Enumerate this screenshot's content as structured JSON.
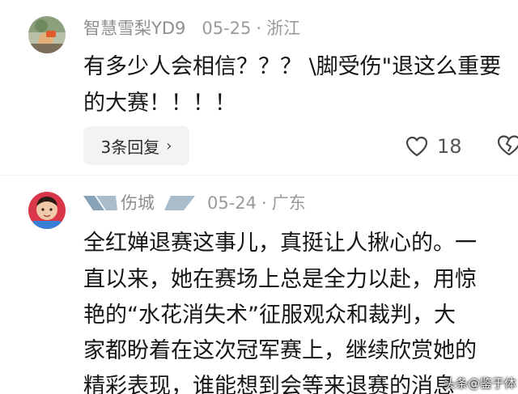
{
  "comments": [
    {
      "username": "智慧雪梨YD9",
      "date": "05-25",
      "location": "浙江",
      "text_lines": [
        "有多少人会相信？？？ \\脚受伤\"退这么重要",
        "的大赛！！！！"
      ],
      "reply_button_label": "3条回复",
      "likes": "18",
      "avatar_icon": "hand-photo-avatar"
    },
    {
      "username": "伤城",
      "date": "05-24",
      "location": "广东",
      "text_lines": [
        "全红婵退赛这事儿，真挺让人揪心的。一",
        "直以来，她在赛场上总是全力以赴，用惊",
        "艳的“水花消失术”征服观众和裁判，大",
        "家都盼着在这次冠军赛上，继续欣赏她的",
        "精彩表现，谁能想到会等来退赛的消息"
      ],
      "avatar_icon": "child-photo-avatar"
    }
  ],
  "watermark": "头条@鉴于体",
  "colors": {
    "text": "#161616",
    "meta": "#9a9a9a",
    "button_bg": "#f3f3f3"
  }
}
